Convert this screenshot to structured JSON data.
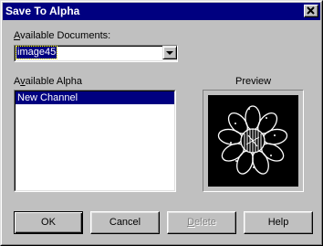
{
  "window": {
    "title": "Save To Alpha",
    "close_glyph": "✕"
  },
  "documents": {
    "label_accel": "A",
    "label_rest": "vailable Documents:",
    "selected": "image45"
  },
  "alpha": {
    "label_pre": "A",
    "label_accel": "v",
    "label_rest": "ailable Alpha",
    "items": [
      "New Channel"
    ]
  },
  "preview": {
    "label": "Preview",
    "image_icon": "flower-icon"
  },
  "buttons": {
    "ok": "OK",
    "cancel": "Cancel",
    "delete_accel": "D",
    "delete_rest": "elete",
    "help": "Help"
  },
  "colors": {
    "face": "#c0c0c0",
    "title_bar": "#000080",
    "selection": "#000080",
    "disabled_text": "#808080"
  }
}
